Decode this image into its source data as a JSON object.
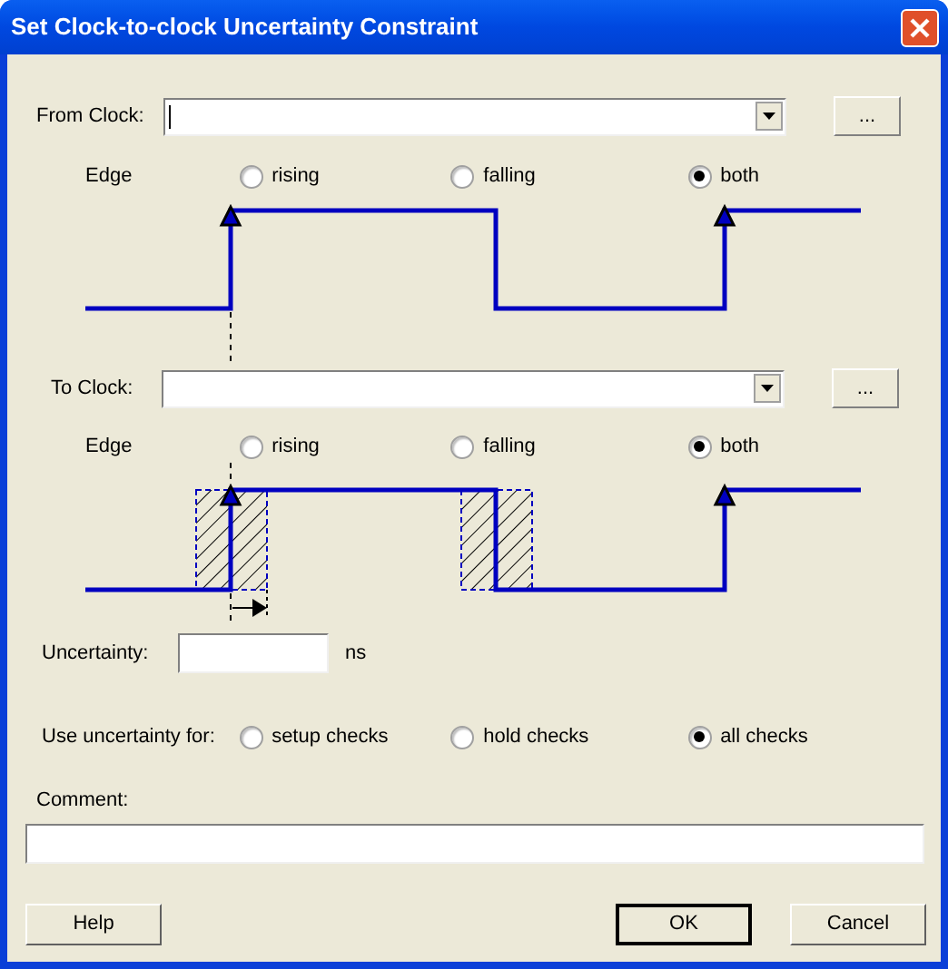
{
  "window": {
    "title": "Set Clock-to-clock Uncertainty Constraint"
  },
  "from_clock": {
    "label": "From Clock:",
    "focused": true,
    "browse": "..."
  },
  "from_edge": {
    "label": "Edge",
    "options": [
      {
        "label": "rising",
        "selected": false
      },
      {
        "label": "falling",
        "selected": false
      },
      {
        "label": "both",
        "selected": true
      }
    ]
  },
  "to_clock": {
    "label": "To Clock:",
    "focused": false,
    "browse": "..."
  },
  "to_edge": {
    "label": "Edge",
    "options": [
      {
        "label": "rising",
        "selected": false
      },
      {
        "label": "falling",
        "selected": false
      },
      {
        "label": "both",
        "selected": true
      }
    ]
  },
  "uncertainty": {
    "label": "Uncertainty:",
    "unit": "ns"
  },
  "use_for": {
    "label": "Use uncertainty for:",
    "options": [
      {
        "label": "setup checks",
        "selected": false
      },
      {
        "label": "hold checks",
        "selected": false
      },
      {
        "label": "all checks",
        "selected": true
      }
    ]
  },
  "comment": {
    "label": "Comment:"
  },
  "buttons": [
    {
      "label": "Help",
      "default": false
    },
    {
      "label": "OK",
      "default": true
    },
    {
      "label": "Cancel",
      "default": false
    }
  ]
}
